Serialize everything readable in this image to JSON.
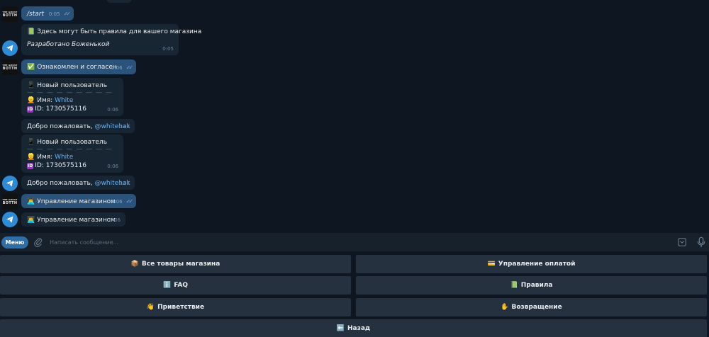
{
  "messages": [
    {
      "id": "m1",
      "direction": "out",
      "text": "/start",
      "time": "0:05"
    },
    {
      "id": "m2",
      "direction": "in",
      "emoji": "📗",
      "text": "Здесь могут быть правила для вашего магазина",
      "footer": "Разработано Боженькой",
      "time": "0:05"
    },
    {
      "id": "m3",
      "direction": "out",
      "emoji": "✅",
      "text": "Ознакомлен и согласен",
      "time": "0:06"
    },
    {
      "id": "m4",
      "direction": "in",
      "emoji": "📱",
      "title": "Новый пользователь",
      "separator": "— — — — — — — — —",
      "name_label": "Имя:",
      "name_value": "White",
      "id_label": "ID: 1730575116",
      "time": "0:06"
    },
    {
      "id": "m5",
      "direction": "in",
      "text": "Добро пожаловать,",
      "mention": "@whitehak",
      "time": "0:06"
    },
    {
      "id": "m6",
      "direction": "in",
      "emoji": "📱",
      "title": "Новый пользователь",
      "separator": "— — — — — — — — —",
      "name_label": "Имя:",
      "name_value": "White",
      "id_label": "ID: 1730575116",
      "time": "0:06"
    },
    {
      "id": "m7",
      "direction": "in",
      "text": "Добро пожаловать,",
      "mention": "@whitehak",
      "time": "0:06"
    },
    {
      "id": "m8",
      "direction": "out",
      "emoji": "👨‍💻",
      "text": "Управление магазином",
      "time": "0:06"
    },
    {
      "id": "m9",
      "direction": "in",
      "emoji": "👨‍💻",
      "text": "Управление магазином",
      "time": "0:06"
    }
  ],
  "user_avatar": {
    "line1": "THE GHOST",
    "line2": "BOTTH"
  },
  "input_bar": {
    "menu_label": "Меню",
    "placeholder": "Написать сообщение..."
  },
  "keyboard": {
    "all_products": {
      "emoji": "📦",
      "label": "Все товары магазина"
    },
    "payment": {
      "emoji": "💳",
      "label": "Управление оплатой"
    },
    "faq": {
      "emoji": "ℹ️",
      "label": "FAQ"
    },
    "rules": {
      "emoji": "📗",
      "label": "Правила"
    },
    "greeting": {
      "emoji": "👋",
      "label": "Приветствие"
    },
    "refund": {
      "emoji": "✋",
      "label": "Возвращение"
    },
    "back": {
      "emoji": "⬅️",
      "label": "Назад"
    }
  },
  "id_badge": "ID",
  "colors": {
    "background": "#0e1621",
    "outgoing_bubble": "#2b5278",
    "incoming_bubble": "#182533",
    "link": "#6ab3f3",
    "button": "#25313e",
    "menu_button": "#2f6ea5"
  },
  "icons": [
    "paperclip-icon",
    "bot-keyboard-icon",
    "microphone-icon",
    "double-check-icon",
    "telegram-plane-icon"
  ]
}
